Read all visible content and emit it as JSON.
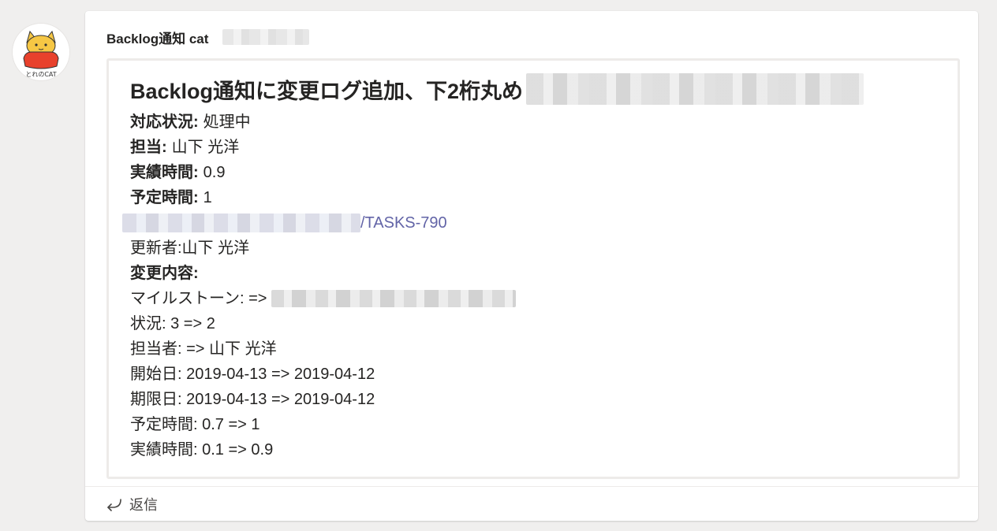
{
  "avatar": {
    "caption": "とれのCAT"
  },
  "message": {
    "sender": "Backlog通知 cat",
    "card": {
      "title": "Backlog通知に変更ログ追加、下2桁丸め",
      "fields": {
        "status_label": "対応状況:",
        "status_value": "処理中",
        "assignee_label": "担当:",
        "assignee_value": "山下 光洋",
        "actual_label": "実績時間:",
        "actual_value": "0.9",
        "planned_label": "予定時間:",
        "planned_value": "1"
      },
      "link_suffix": "/TASKS-790",
      "updater": "更新者:山下 光洋",
      "changes_label": "変更内容:",
      "changes": {
        "milestone": "マイルストーン: =>",
        "status": "状況: 3 => 2",
        "assignee": "担当者: => 山下 光洋",
        "start_date": "開始日: 2019-04-13 => 2019-04-12",
        "due_date": "期限日: 2019-04-13 => 2019-04-12",
        "planned_hours": "予定時間: 0.7 => 1",
        "actual_hours": "実績時間: 0.1 => 0.9"
      }
    }
  },
  "reply": {
    "label": "返信"
  },
  "colors": {
    "background": "#f0efee",
    "link": "#6264a7",
    "text": "#252423"
  }
}
